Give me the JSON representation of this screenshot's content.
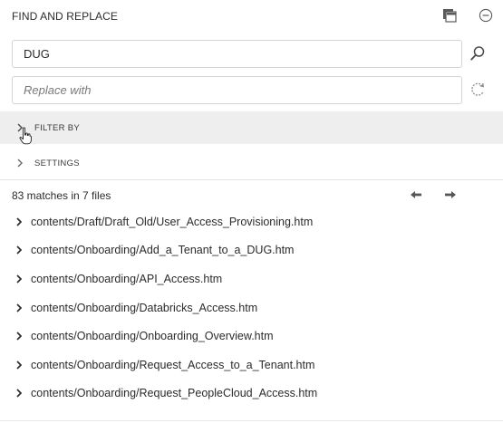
{
  "panel": {
    "title": "FIND AND REPLACE",
    "dock_icon": "dock-panel-icon",
    "more_icon": "more-options-icon"
  },
  "find": {
    "value": "DUG",
    "search_icon": "search-icon"
  },
  "replace": {
    "value": "",
    "placeholder": "Replace with",
    "replace_icon": "replace-refresh-icon"
  },
  "sections": {
    "filter_label": "FILTER BY",
    "settings_label": "SETTINGS"
  },
  "results": {
    "summary": "83 matches in 7 files",
    "prev_icon": "arrow-left-icon",
    "next_icon": "arrow-right-icon",
    "files": [
      "contents/Draft/Draft_Old/User_Access_Provisioning.htm",
      "contents/Onboarding/Add_a_Tenant_to_a_DUG.htm",
      "contents/Onboarding/API_Access.htm",
      "contents/Onboarding/Databricks_Access.htm",
      "contents/Onboarding/Onboarding_Overview.htm",
      "contents/Onboarding/Request_Access_to_a_Tenant.htm",
      "contents/Onboarding/Request_PeopleCloud_Access.htm"
    ]
  }
}
